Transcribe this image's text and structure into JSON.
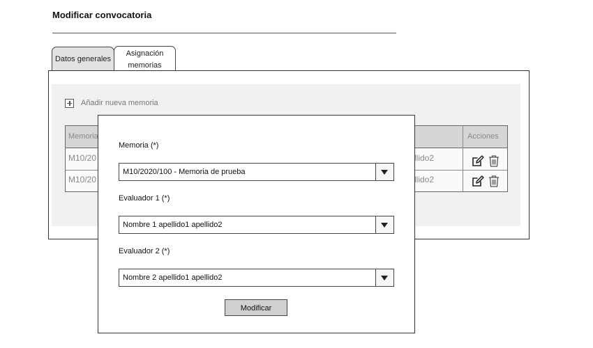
{
  "page": {
    "title": "Modificar convocatoria"
  },
  "tabs": [
    {
      "label": "Datos generales"
    },
    {
      "label": "Asignación memorias"
    }
  ],
  "panel": {
    "add_label": "Añadir nueva memoria",
    "table": {
      "headers": [
        "Memoria",
        "Acciones"
      ],
      "rows": [
        {
          "memoria": "M10/20",
          "evaluador": "llido2"
        },
        {
          "memoria": "M10/20",
          "evaluador": "llido2"
        }
      ]
    }
  },
  "modal": {
    "memoria_label": "Memoria (*)",
    "memoria_value": "M10/2020/100 - Memoria de prueba",
    "evaluador1_label": "Evaluador 1 (*)",
    "evaluador1_value": "Nombre 1 apellido1 apellido2",
    "evaluador2_label": "Evaluador 2 (*)",
    "evaluador2_value": "Nombre 2 apellido1 apellido2",
    "submit_label": "Modificar"
  },
  "icons": {
    "add": "plus-square-icon",
    "edit": "edit-icon",
    "delete": "trash-icon",
    "dropdown": "chevron-down-icon"
  }
}
